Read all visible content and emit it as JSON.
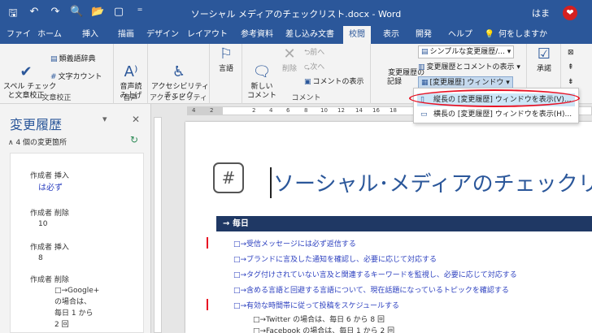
{
  "window": {
    "title": "ソーシャル メディアのチェックリスト.docx - Word",
    "user": "はま",
    "avatar": "❤"
  },
  "tabs": [
    "ファイル",
    "ホーム",
    "挿入",
    "描画",
    "デザイン",
    "レイアウト",
    "参考資料",
    "差し込み文書",
    "校閲",
    "表示",
    "開発",
    "ヘルプ",
    "何をしますか"
  ],
  "ribbon": {
    "proofing": {
      "label": "文章校正",
      "spell": "スペル チェック\nと文章校正",
      "thesaurus": "類義語辞典",
      "wordcount": "文字カウント"
    },
    "speech": {
      "label": "音声",
      "read": "音声読\nみ上げ"
    },
    "accessibility": {
      "label": "アクセシビリティ",
      "check": "アクセシビリティ\nチェック"
    },
    "language": {
      "label": "言語"
    },
    "comments": {
      "label": "コメント",
      "new": "新しい\nコメント",
      "delete": "削除",
      "prev": "前へ",
      "next": "次へ",
      "show": "コメントの表示"
    },
    "tracking": {
      "record": "変更履歴の\n記録",
      "simple_markup": "シンプルな変更履歴/...",
      "show_markup": "変更履歴とコメントの表示",
      "pane_button": "[変更履歴] ウィンドウ"
    },
    "accept": {
      "label": "承諾"
    }
  },
  "dropdown": {
    "vertical": "縦長の [変更履歴] ウィンドウを表示(V)...",
    "horizontal": "横長の [変更履歴] ウィンドウを表示(H)..."
  },
  "pane": {
    "title": "変更履歴",
    "count": "4 個の変更箇所",
    "revisions": [
      {
        "header": "作成者 挿入",
        "body": "は必ず"
      },
      {
        "header": "作成者 削除",
        "body": "10"
      },
      {
        "header": "作成者 挿入",
        "body": "8"
      },
      {
        "header": "作成者 削除",
        "body": "□→Google+\nの場合は、\n毎日 1 から\n2 回"
      }
    ]
  },
  "ruler": [
    "4",
    "2",
    "2",
    "4",
    "6",
    "8",
    "10",
    "12",
    "14",
    "16",
    "18"
  ],
  "document": {
    "heading": "ソーシャル･メディアのチェックリ",
    "section": "→ 毎日",
    "items": [
      "□→受信メッセージには必ず返信する",
      "□→ブランドに言及した通知を確認し、必要に応じて対応する",
      "□→タグ付けされていない言及と関連するキーワードを監視し、必要に応じて対応する",
      "□→含める言語と回避する言語について、現在話題になっているトピックを確認する",
      "□→有効な時間帯に従って投稿をスケジュールする"
    ],
    "subitems": [
      "□→Twitter の場合は、毎日 6 から 8 回",
      "□→Facebook の場合は、毎日 1 から 2 回"
    ]
  }
}
